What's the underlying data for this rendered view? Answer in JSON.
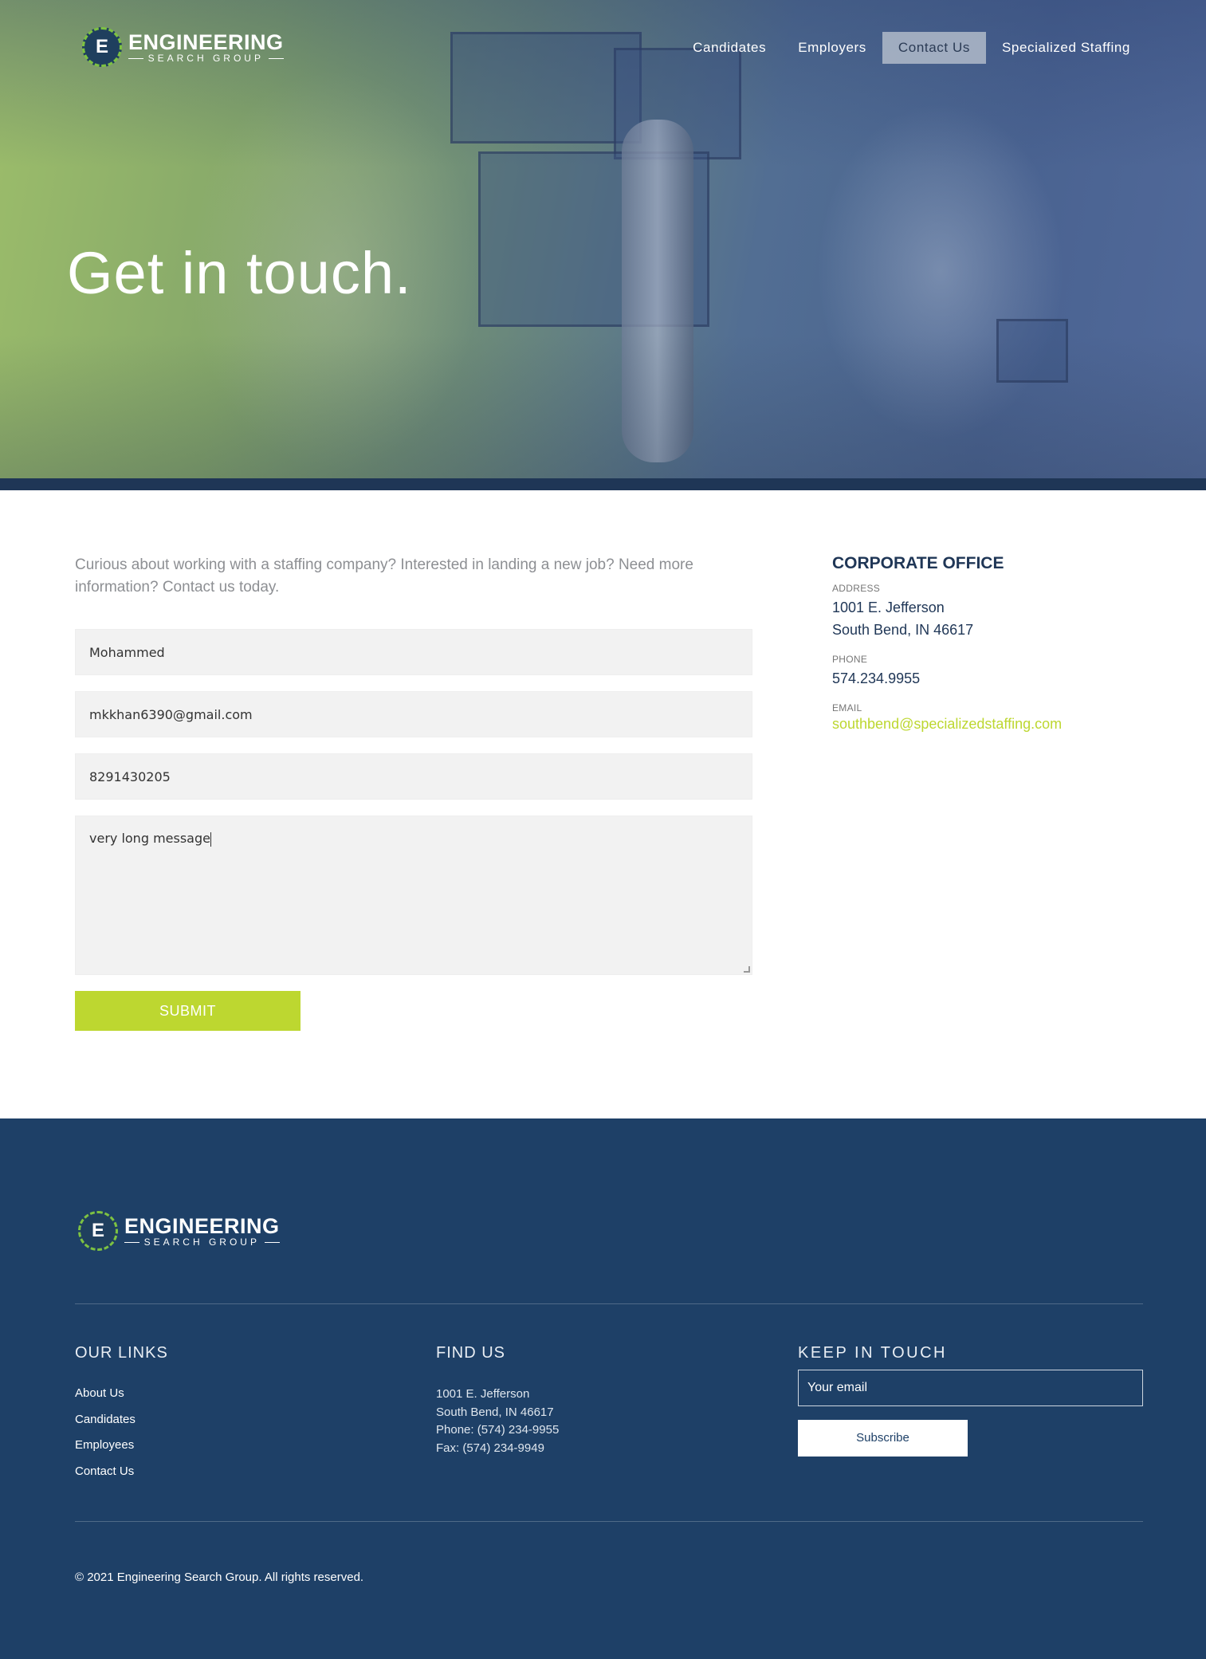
{
  "brand": {
    "logo_letter": "E",
    "name_line1": "ENGINEERING",
    "name_line2": "SEARCH GROUP",
    "accent": "#bdd730",
    "navy": "#1f3656",
    "footer_bg": "#1e4067"
  },
  "nav": {
    "items": [
      {
        "label": "Candidates",
        "active": false
      },
      {
        "label": "Employers",
        "active": false
      },
      {
        "label": "Contact Us",
        "active": true
      },
      {
        "label": "Specialized Staffing",
        "active": false
      }
    ]
  },
  "hero": {
    "title": "Get in touch."
  },
  "form": {
    "intro": "Curious about working with a staffing company? Interested in landing a new job? Need more information? Contact us today.",
    "name_value": "Mohammed",
    "email_value": "mkkhan6390@gmail.com",
    "phone_value": "8291430205",
    "message_value": "very long message",
    "submit_label": "SUBMIT"
  },
  "office": {
    "title": "CORPORATE OFFICE",
    "address_label": "ADDRESS",
    "address_line1": "1001 E. Jefferson",
    "address_line2": "South Bend, IN 46617",
    "phone_label": "PHONE",
    "phone": "574.234.9955",
    "email_label": "EMAIL",
    "email": "southbend@specializedstaffing.com"
  },
  "footer": {
    "links_heading": "OUR LINKS",
    "links": [
      "About Us",
      "Candidates",
      "Employees",
      "Contact Us"
    ],
    "find_heading": "FIND US",
    "find_lines": [
      "1001 E. Jefferson",
      "South Bend, IN 46617",
      "Phone: (574) 234-9955",
      "Fax: (574) 234-9949"
    ],
    "keep_heading": "KEEP IN TOUCH",
    "email_placeholder": "Your email",
    "subscribe_label": "Subscribe",
    "copyright": "© 2021 Engineering Search Group. All rights reserved."
  }
}
